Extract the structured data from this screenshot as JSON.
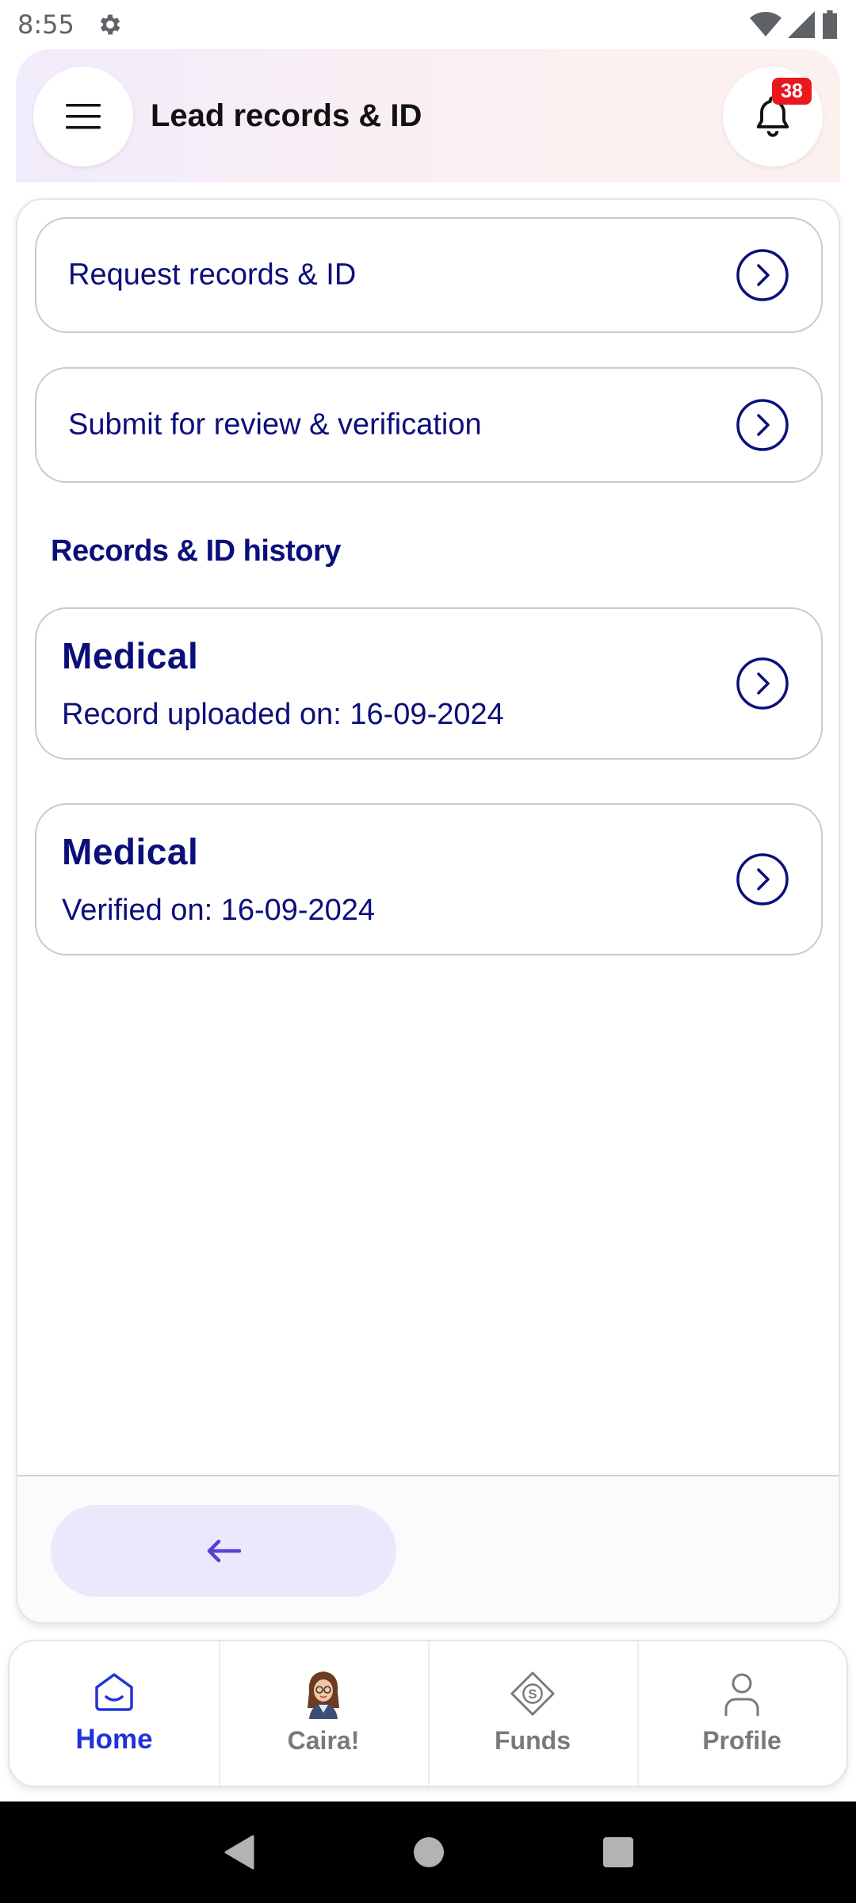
{
  "status_bar": {
    "time": "8:55"
  },
  "header": {
    "title": "Lead records & ID",
    "notification_count": "38"
  },
  "actions": [
    {
      "label": "Request records & ID"
    },
    {
      "label": "Submit for review & verification"
    }
  ],
  "history": {
    "section_title": "Records & ID history",
    "items": [
      {
        "title": "Medical",
        "subtitle": "Record uploaded on: 16-09-2024"
      },
      {
        "title": "Medical",
        "subtitle": "Verified on: 16-09-2024"
      }
    ]
  },
  "bottom_nav": {
    "items": [
      {
        "label": "Home",
        "icon": "home-icon",
        "active": true
      },
      {
        "label": "Caira!",
        "icon": "caira-avatar-icon",
        "active": false
      },
      {
        "label": "Funds",
        "icon": "funds-icon",
        "active": false
      },
      {
        "label": "Profile",
        "icon": "profile-icon",
        "active": false
      }
    ]
  },
  "colors": {
    "primary_text": "#0b0f7a",
    "active_nav": "#2232d8",
    "badge": "#e8181e",
    "back_button_bg": "#ece8fb",
    "back_arrow": "#5b3fd6"
  }
}
